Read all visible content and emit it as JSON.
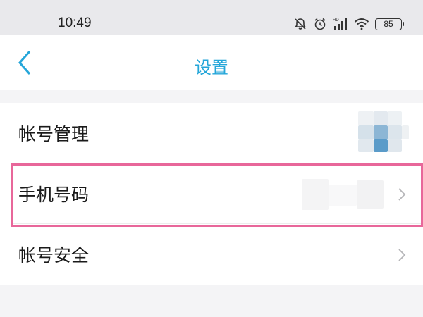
{
  "status_bar": {
    "time": "10:49",
    "battery": "85"
  },
  "header": {
    "title": "设置"
  },
  "settings": {
    "items": [
      {
        "label": "帐号管理"
      },
      {
        "label": "手机号码"
      },
      {
        "label": "帐号安全"
      }
    ]
  },
  "colors": {
    "accent": "#24a6d9",
    "highlight": "#e8679a"
  }
}
